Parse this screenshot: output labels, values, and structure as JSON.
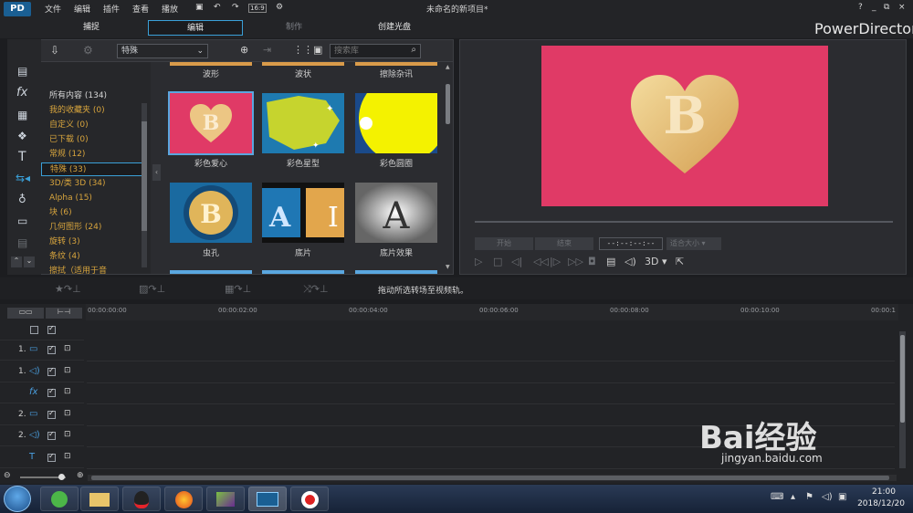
{
  "app": {
    "logo_text": "PD",
    "menus": [
      "文件",
      "编辑",
      "插件",
      "查看",
      "播放"
    ],
    "doc_title": "未命名的新项目*",
    "brand": "PowerDirector",
    "window_controls": [
      "?",
      "_",
      "⧉",
      "×"
    ]
  },
  "modes": [
    "捕捉",
    "编辑",
    "制作",
    "创建光盘"
  ],
  "active_mode": "编辑",
  "library": {
    "category_dropdown": "特殊",
    "search_placeholder": "搜索库",
    "categories": [
      {
        "label": "所有内容 (134)",
        "color": "#d6d6d6"
      },
      {
        "label": "我的收藏夹 (0)",
        "color": "#d7a43d"
      },
      {
        "label": "自定义 (0)",
        "color": "#d7a43d"
      },
      {
        "label": "已下载 (0)",
        "color": "#d7a43d"
      },
      {
        "label": "常规 (12)",
        "color": "#d7a43d"
      },
      {
        "label": "特殊 (33)",
        "color": "#d7a43d"
      },
      {
        "label": "3D/类 3D (34)",
        "color": "#d7a43d"
      },
      {
        "label": "Alpha (15)",
        "color": "#d7a43d"
      },
      {
        "label": "块 (6)",
        "color": "#d7a43d"
      },
      {
        "label": "几何图形 (24)",
        "color": "#d7a43d"
      },
      {
        "label": "旋转 (3)",
        "color": "#d7a43d"
      },
      {
        "label": "条纹 (4)",
        "color": "#d7a43d"
      },
      {
        "label": "擦拭（适用于音",
        "color": "#d7a43d"
      }
    ],
    "top_row_labels": [
      "波形",
      "波状",
      "擦除杂讯"
    ],
    "transitions": [
      {
        "label": "彩色爱心",
        "style": "heart"
      },
      {
        "label": "彩色星型",
        "style": "star"
      },
      {
        "label": "彩色圆圈",
        "style": "circle"
      },
      {
        "label": "虫孔",
        "style": "wormhole"
      },
      {
        "label": "底片",
        "style": "film"
      },
      {
        "label": "底片效果",
        "style": "negative"
      }
    ]
  },
  "preview": {
    "btn_start": "开始",
    "btn_end": "结束",
    "timecode": "--:--:--:--",
    "fit": "适合大小",
    "mode_3d": "3D"
  },
  "editbar": {
    "hint": "拖动所选转场至视频轨。"
  },
  "timeline": {
    "ruler": [
      "00:00:00:00",
      "00:00:02:00",
      "00:00:04:00",
      "00:00:06:00",
      "00:00:08:00",
      "00:00:10:00",
      "00:00:1"
    ],
    "tracks": [
      {
        "num": "1.",
        "type": "video-icon"
      },
      {
        "num": "1.",
        "type": "audio-icon"
      },
      {
        "num": "",
        "type": "fx-icon"
      },
      {
        "num": "2.",
        "type": "video-icon"
      },
      {
        "num": "2.",
        "type": "audio-icon"
      },
      {
        "num": "",
        "type": "text-icon"
      }
    ]
  },
  "taskbar": {
    "time": "21:00",
    "date": "2018/12/20"
  },
  "watermark": {
    "brand": "Bai经验",
    "url": "jingyan.baidu.com"
  },
  "colors": {
    "accent": "#3aa0d8",
    "category_text": "#d7a43d",
    "preview_bg": "#e03a66",
    "heart_gold": "#e9c37c"
  }
}
